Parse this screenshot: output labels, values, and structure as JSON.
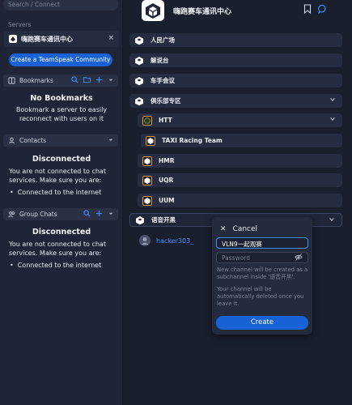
{
  "sidebar": {
    "search_placeholder": "Search / Connect",
    "servers_label": "Servers",
    "server": {
      "name": "嗨跑赛车通讯中心",
      "close": "×"
    },
    "create_community_label": "Create a TeamSpeak Community",
    "bookmarks": {
      "label": "Bookmarks",
      "title": "No Bookmarks",
      "text": "Bookmark a server to easily reconnect with users on it"
    },
    "contacts": {
      "label": "Contacts",
      "title": "Disconnected",
      "text": "You are not connected to chat services. Make sure you are:",
      "bullet": "Connected to the internet"
    },
    "group_chats": {
      "label": "Group Chats",
      "title": "Disconnected",
      "text": "You are not connected to chat services. Make sure you are:",
      "bullet": "Connected to the internet"
    }
  },
  "main": {
    "server_name": "嗨跑赛车通讯中心",
    "channels": [
      {
        "name": "人民广场"
      },
      {
        "name": "解说台"
      },
      {
        "name": "车手会议"
      },
      {
        "name": "俱乐部专区"
      },
      {
        "name": "HTT"
      },
      {
        "name": "TAXI Racing Team"
      },
      {
        "name": "HMR"
      },
      {
        "name": "UQR"
      },
      {
        "name": "UUM"
      },
      {
        "name": "语音开黑"
      }
    ],
    "user": {
      "name": "hacker303_"
    }
  },
  "popup": {
    "cancel_label": "Cancel",
    "channel_name_value": "VLN9一起观赛",
    "password_placeholder": "Password",
    "note_1": "New channel will be created as a subchannel inside '语音开黑'.",
    "note_2": "Your channel will be automatically deleted once you leave it.",
    "create_label": "Create"
  },
  "colors": {
    "accent": "#1762d6",
    "link": "#3b8cff",
    "orange": "#f29a1f"
  }
}
